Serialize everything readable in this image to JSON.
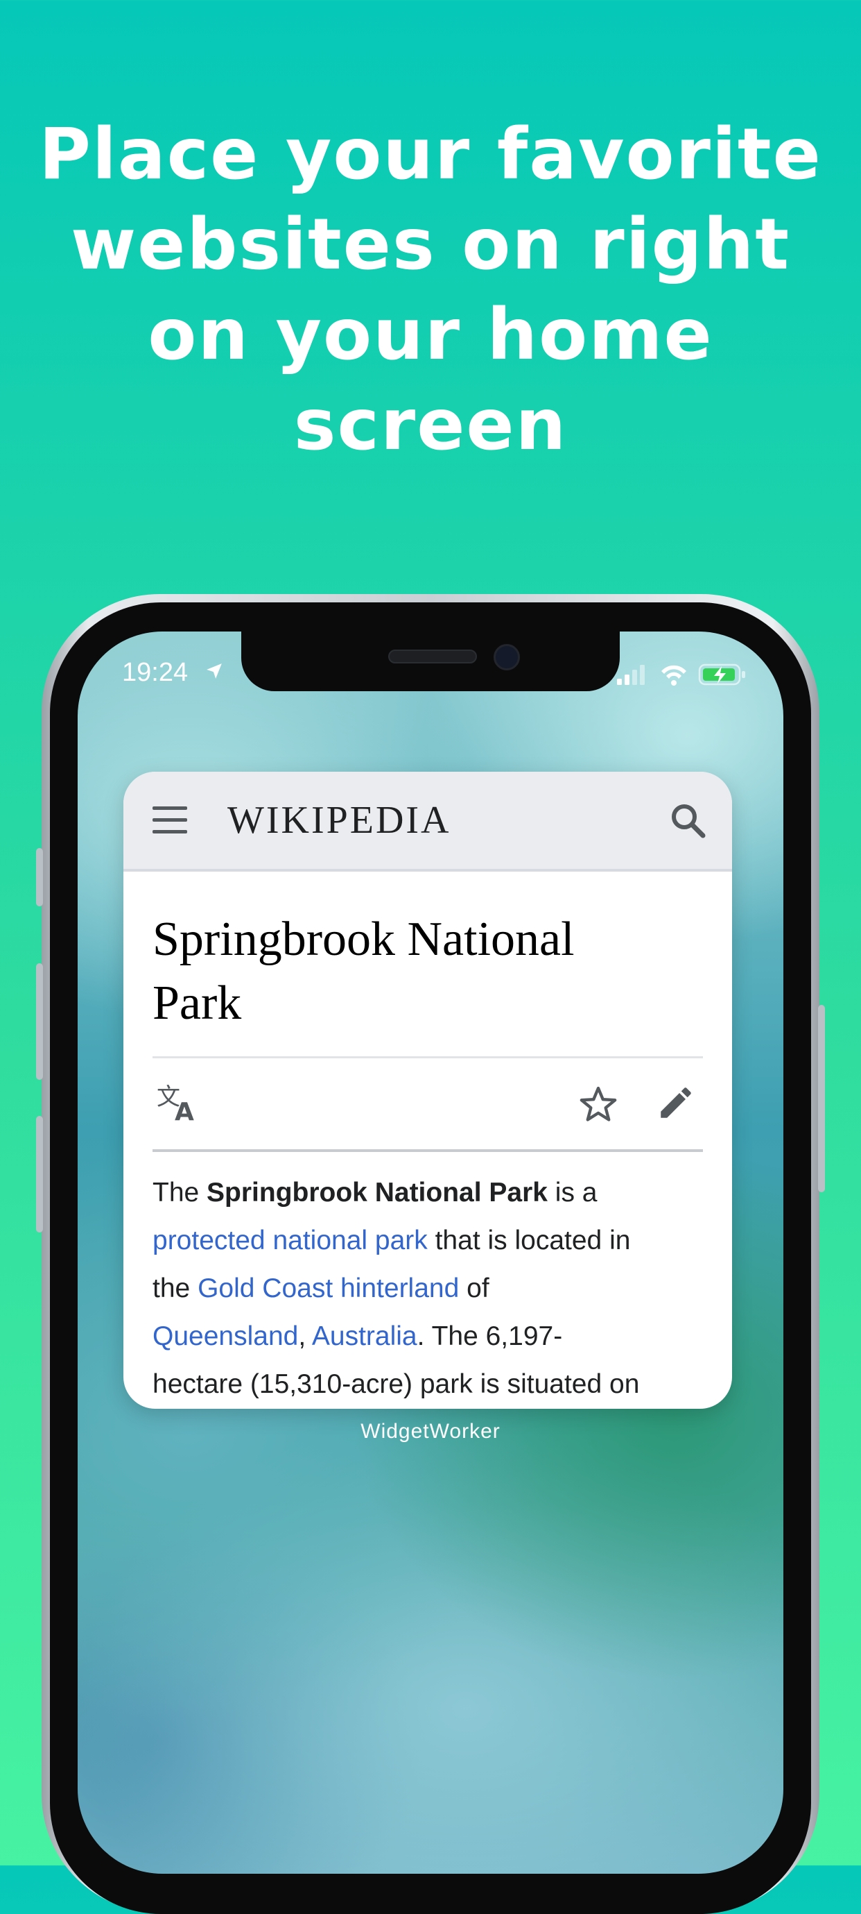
{
  "headline": {
    "lines": [
      "Place your favorite",
      "websites on right",
      "on your home",
      "screen"
    ]
  },
  "status_bar": {
    "time": "19:24"
  },
  "widget": {
    "site_name": "Wikipedia",
    "wordmark": "WIKIPEDIA",
    "article": {
      "title_line1": "Springbrook National",
      "title_line2": "Park",
      "body": {
        "p1": "The ",
        "b1": "Springbrook National Park",
        "p2": " is a",
        "l1": "protected national park",
        "p3": " that is located in",
        "p4": "the ",
        "l2": "Gold Coast hinterland",
        "p5": " of",
        "l3": "Queensland",
        "p6": ", ",
        "l4": "Australia",
        "p7": ". The 6,197-",
        "p8": "hectare (15,310-acre) park is situated on"
      }
    },
    "label": "WidgetWorker"
  },
  "colors": {
    "background_top": "#06c8b8",
    "background_bottom": "#47f2a2",
    "link": "#3366cc",
    "header_bg": "#eaecf0"
  },
  "icons": [
    "location-arrow-icon",
    "signal-icon",
    "wifi-icon",
    "battery-charging-icon",
    "menu-icon",
    "search-icon",
    "translate-icon",
    "star-icon",
    "pencil-icon"
  ]
}
